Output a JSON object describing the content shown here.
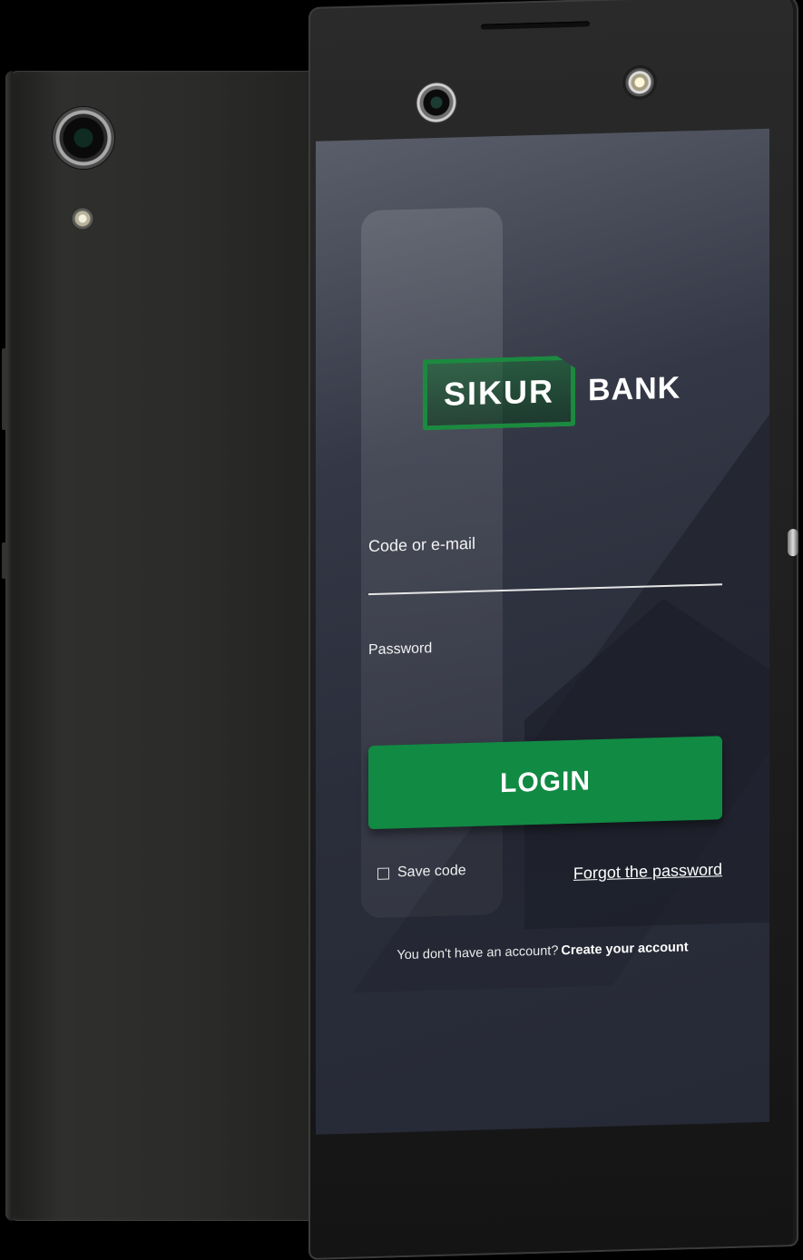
{
  "logo": {
    "word": "SIKUR",
    "bank": "BANK",
    "accent_color": "#1b8a3f"
  },
  "login_form": {
    "code_label": "Code or e-mail",
    "code_value": "",
    "password_label": "Password",
    "password_value": "",
    "login_button": "LOGIN",
    "login_button_color": "#118a43",
    "save_code_label": "Save code",
    "save_code_checked": false,
    "forgot_link": "Forgot the password"
  },
  "signup": {
    "prompt": "You don't have an account?",
    "link": "Create your account"
  },
  "icons": {
    "checkbox": "square-outline-icon"
  }
}
